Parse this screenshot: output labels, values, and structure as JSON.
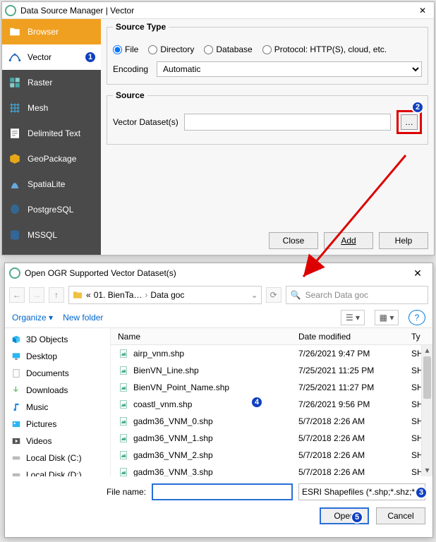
{
  "dsm": {
    "title": "Data Source Manager | Vector",
    "sidebar": [
      {
        "label": "Browser"
      },
      {
        "label": "Vector"
      },
      {
        "label": "Raster"
      },
      {
        "label": "Mesh"
      },
      {
        "label": "Delimited Text"
      },
      {
        "label": "GeoPackage"
      },
      {
        "label": "SpatiaLite"
      },
      {
        "label": "PostgreSQL"
      },
      {
        "label": "MSSQL"
      }
    ],
    "source_type_legend": "Source Type",
    "radios": {
      "file": "File",
      "directory": "Directory",
      "database": "Database",
      "protocol": "Protocol: HTTP(S), cloud, etc."
    },
    "encoding_label": "Encoding",
    "encoding_value": "Automatic",
    "source_legend": "Source",
    "vector_datasets_label": "Vector Dataset(s)",
    "browse_label": "…",
    "buttons": {
      "close": "Close",
      "add": "Add",
      "help": "Help"
    },
    "badge1": "1",
    "badge2": "2"
  },
  "filedlg": {
    "title": "Open OGR Supported Vector Dataset(s)",
    "crumb": [
      "01. BienTa…",
      "Data goc"
    ],
    "search_placeholder": "Search Data goc",
    "organize": "Organize",
    "new_folder": "New folder",
    "headers": {
      "name": "Name",
      "date": "Date modified",
      "type": "Ty"
    },
    "tree": [
      {
        "label": "3D Objects"
      },
      {
        "label": "Desktop"
      },
      {
        "label": "Documents"
      },
      {
        "label": "Downloads"
      },
      {
        "label": "Music"
      },
      {
        "label": "Pictures"
      },
      {
        "label": "Videos"
      },
      {
        "label": "Local Disk (C:)"
      },
      {
        "label": "Local Disk (D:)"
      }
    ],
    "rows": [
      {
        "name": "airp_vnm.shp",
        "date": "7/26/2021 9:47 PM",
        "type": "SH"
      },
      {
        "name": "BienVN_Line.shp",
        "date": "7/25/2021 11:25 PM",
        "type": "SH"
      },
      {
        "name": "BienVN_Point_Name.shp",
        "date": "7/25/2021 11:27 PM",
        "type": "SH"
      },
      {
        "name": "coastl_vnm.shp",
        "date": "7/26/2021 9:56 PM",
        "type": "SH"
      },
      {
        "name": "gadm36_VNM_0.shp",
        "date": "5/7/2018 2:26 AM",
        "type": "SH"
      },
      {
        "name": "gadm36_VNM_1.shp",
        "date": "5/7/2018 2:26 AM",
        "type": "SH"
      },
      {
        "name": "gadm36_VNM_2.shp",
        "date": "5/7/2018 2:26 AM",
        "type": "SH"
      },
      {
        "name": "gadm36_VNM_3.shp",
        "date": "5/7/2018 2:26 AM",
        "type": "SH"
      }
    ],
    "filename_label": "File name:",
    "filetypes": "ESRI Shapefiles (*.shp;*.shz;*.sh",
    "open": "Open",
    "cancel": "Cancel",
    "badge3": "3",
    "badge4": "4",
    "badge5": "5"
  }
}
